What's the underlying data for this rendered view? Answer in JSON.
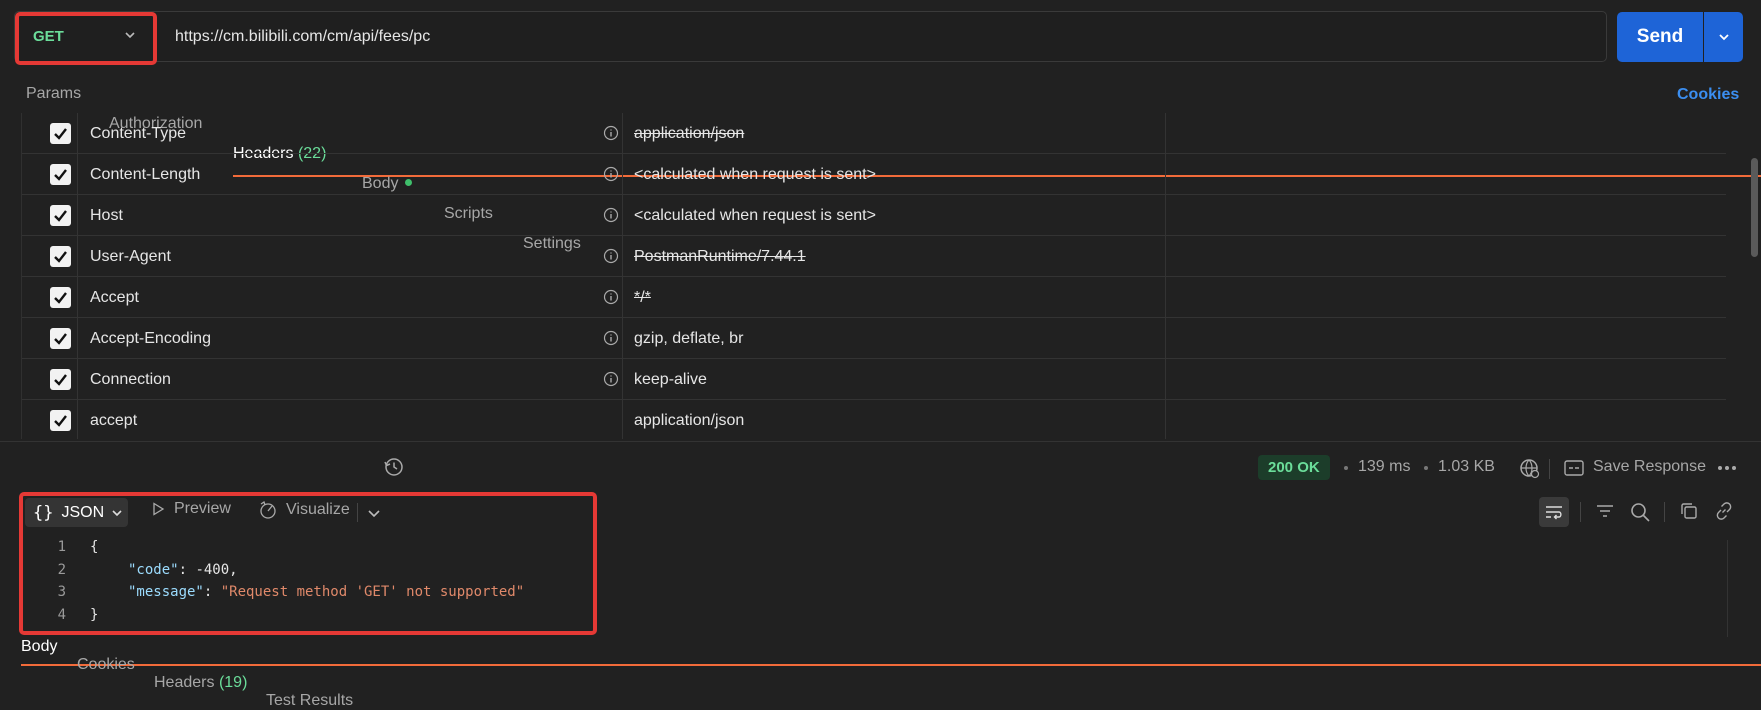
{
  "request": {
    "method": "GET",
    "url": "https://cm.bilibili.com/cm/api/fees/pc",
    "send_label": "Send"
  },
  "request_tabs": [
    {
      "label": "Params"
    },
    {
      "label": "Authorization"
    },
    {
      "label": "Headers",
      "count": "(22)"
    },
    {
      "label": "Body"
    },
    {
      "label": "Scripts"
    },
    {
      "label": "Settings"
    }
  ],
  "cookies_link": "Cookies",
  "headers_table": [
    {
      "key": "Content-Type",
      "value": "application/json",
      "struck": true,
      "info": true
    },
    {
      "key": "Content-Length",
      "value": "<calculated when request is sent>",
      "struck": false,
      "info": true
    },
    {
      "key": "Host",
      "value": "<calculated when request is sent>",
      "struck": false,
      "info": true
    },
    {
      "key": "User-Agent",
      "value": "PostmanRuntime/7.44.1",
      "struck": true,
      "info": true
    },
    {
      "key": "Accept",
      "value": "*/*",
      "struck": true,
      "info": true
    },
    {
      "key": "Accept-Encoding",
      "value": "gzip, deflate, br",
      "struck": false,
      "info": true
    },
    {
      "key": "Connection",
      "value": "keep-alive",
      "struck": false,
      "info": true
    },
    {
      "key": "accept",
      "value": "application/json",
      "struck": false,
      "info": false
    }
  ],
  "response_tabs": [
    {
      "label": "Body"
    },
    {
      "label": "Cookies"
    },
    {
      "label": "Headers",
      "count": "(19)"
    },
    {
      "label": "Test Results"
    }
  ],
  "response_meta": {
    "status": "200 OK",
    "time": "139 ms",
    "size": "1.03 KB",
    "save_label": "Save Response"
  },
  "body_toolbar": {
    "format": "JSON",
    "preview": "Preview",
    "visualize": "Visualize"
  },
  "response_body": {
    "line_numbers": [
      "1",
      "2",
      "3",
      "4"
    ],
    "open_brace": "{",
    "close_brace": "}",
    "code_key": "\"code\"",
    "code_value": "-400,",
    "message_key": "\"message\"",
    "message_value": "\"Request method 'GET' not supported\"",
    "colon": ": "
  },
  "colors": {
    "accent_send": "#1e64d7",
    "method_green": "#6bdd9a",
    "tab_underline": "#f26b3a",
    "highlight_red": "#e53935",
    "link_blue": "#3b8ef0"
  }
}
